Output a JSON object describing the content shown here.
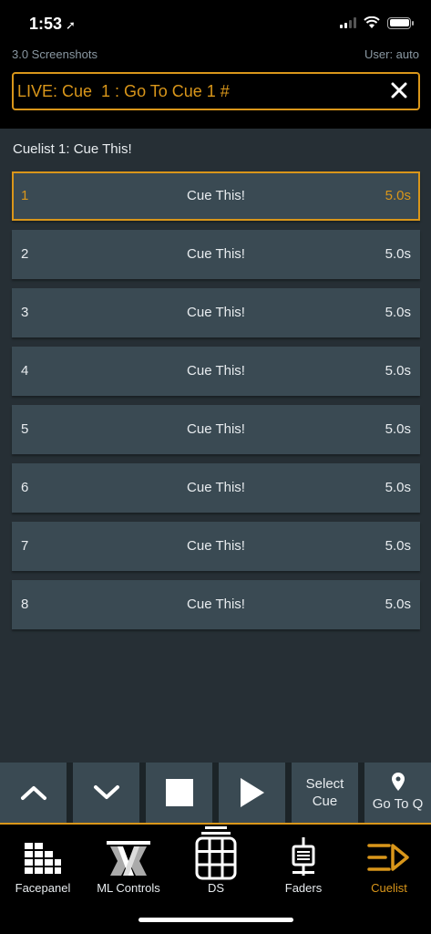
{
  "status": {
    "time": "1:53"
  },
  "header": {
    "left_label": "3.0 Screenshots",
    "right_label": "User: auto",
    "live_text": "LIVE: Cue  1 : Go To Cue 1 #"
  },
  "cuelist": {
    "title": "Cuelist 1: Cue This!",
    "cues": [
      {
        "number": "1",
        "name": "Cue This!",
        "time": "5.0s",
        "active": true
      },
      {
        "number": "2",
        "name": "Cue This!",
        "time": "5.0s",
        "active": false
      },
      {
        "number": "3",
        "name": "Cue This!",
        "time": "5.0s",
        "active": false
      },
      {
        "number": "4",
        "name": "Cue This!",
        "time": "5.0s",
        "active": false
      },
      {
        "number": "5",
        "name": "Cue This!",
        "time": "5.0s",
        "active": false
      },
      {
        "number": "6",
        "name": "Cue This!",
        "time": "5.0s",
        "active": false
      },
      {
        "number": "7",
        "name": "Cue This!",
        "time": "5.0s",
        "active": false
      },
      {
        "number": "8",
        "name": "Cue This!",
        "time": "5.0s",
        "active": false
      }
    ]
  },
  "transport": {
    "up_icon": "chevron-up-icon",
    "down_icon": "chevron-down-icon",
    "stop_icon": "stop-icon",
    "play_icon": "play-icon",
    "select_cue_line1": "Select",
    "select_cue_line2": "Cue",
    "go_to_q_label": "Go To Q"
  },
  "tabs": [
    {
      "label": "Facepanel",
      "icon": "facepanel-icon",
      "active": false
    },
    {
      "label": "ML Controls",
      "icon": "ml-controls-icon",
      "active": false
    },
    {
      "label": "DS",
      "icon": "ds-grid-icon",
      "active": false
    },
    {
      "label": "Faders",
      "icon": "fader-icon",
      "active": false
    },
    {
      "label": "Cuelist",
      "icon": "cuelist-icon",
      "active": true
    }
  ],
  "colors": {
    "accent": "#d9961a",
    "row_bg": "#3a4a53",
    "page_bg": "#262f35",
    "header_bg": "#000000"
  }
}
